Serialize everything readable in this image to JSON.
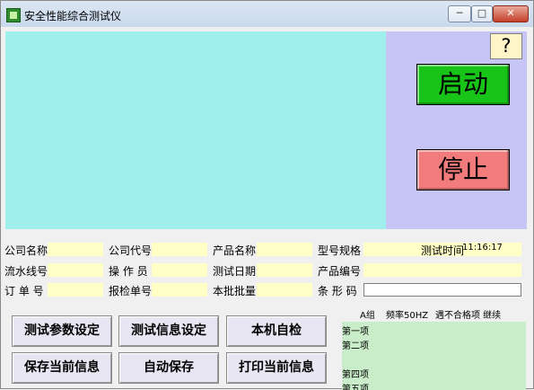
{
  "window": {
    "title": "安全性能综合测试仪",
    "minimize": "─",
    "maximize": "□",
    "close": "✕"
  },
  "side_panel": {
    "help": "?",
    "start": "启动",
    "stop": "停止"
  },
  "fields": {
    "company_name": "公司名称",
    "company_code": "公司代号",
    "product_name": "产品名称",
    "model_spec": "型号规格",
    "test_time_label": "测试时间",
    "test_time_value": "11:16:17",
    "serial_number": "流水线号",
    "operator": "操 作 员",
    "test_date": "测试日期",
    "product_code": "产品编号",
    "order_number": "订 单 号",
    "report_number": "报检单号",
    "batch_quantity": "本批批量",
    "barcode": "条 形 码"
  },
  "buttons": {
    "test_params": "测试参数设定",
    "test_info": "测试信息设定",
    "self_check": "本机自检",
    "save_current": "保存当前信息",
    "auto_save": "自动保存",
    "print_current": "打印当前信息"
  },
  "status": {
    "group": "A组",
    "frequency": "频率50HZ",
    "fail_action": "遇不合格项 继续",
    "items": [
      "第一项",
      "第二项",
      "",
      "第四项",
      "第五项"
    ]
  }
}
